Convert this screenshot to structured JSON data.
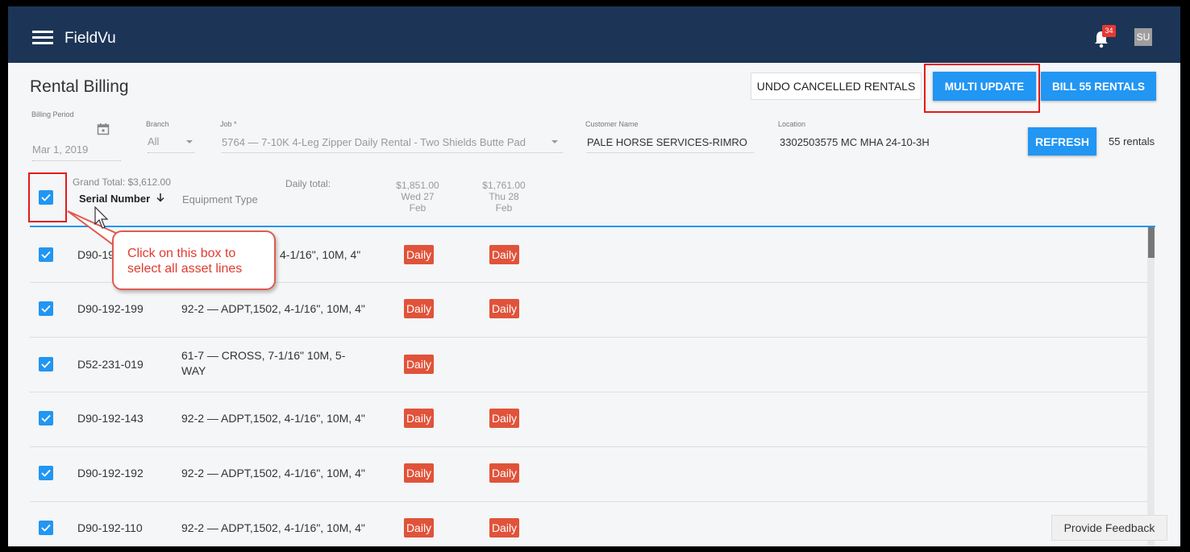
{
  "app": {
    "title": "FieldVu",
    "notification_count": "34",
    "user_initials": "SU"
  },
  "page": {
    "title": "Rental Billing"
  },
  "actions": {
    "undo_label": "UNDO CANCELLED RENTALS",
    "multi_update_label": "MULTI UPDATE",
    "bill_label": "BILL 55 RENTALS",
    "refresh_label": "REFRESH",
    "rentals_count": "55 rentals"
  },
  "filters": {
    "billing_period_label": "Billing Period",
    "billing_period_value": "Mar 1, 2019",
    "branch_label": "Branch",
    "branch_value": "All",
    "job_label": "Job *",
    "job_value": "5764 — 7-10K 4-Leg Zipper Daily Rental - Two Shields Butte Pad",
    "customer_label": "Customer Name",
    "customer_value": "PALE HORSE SERVICES-RIMRO",
    "location_label": "Location",
    "location_value": "3302503575 MC MHA 24-10-3H"
  },
  "table": {
    "grand_total": "Grand Total: $3,612.00",
    "daily_total_label": "Daily total:",
    "serial_header": "Serial Number",
    "equipment_header": "Equipment Type",
    "date_columns": [
      {
        "total": "$1,851.00",
        "day": "Wed 27",
        "month": "Feb"
      },
      {
        "total": "$1,761.00",
        "day": "Thu 28",
        "month": "Feb"
      }
    ],
    "rows": [
      {
        "serial": "D90-19",
        "equipment": "4-1/16\", 10M, 4\"",
        "col1": "Daily",
        "col2": "Daily"
      },
      {
        "serial": "D90-192-199",
        "equipment": "92-2 — ADPT,1502, 4-1/16\", 10M, 4\"",
        "col1": "Daily",
        "col2": "Daily"
      },
      {
        "serial": "D52-231-019",
        "equipment": "61-7 — CROSS, 7-1/16\" 10M, 5-WAY",
        "col1": "Daily",
        "col2": ""
      },
      {
        "serial": "D90-192-143",
        "equipment": "92-2 — ADPT,1502, 4-1/16\", 10M, 4\"",
        "col1": "Daily",
        "col2": "Daily"
      },
      {
        "serial": "D90-192-192",
        "equipment": "92-2 — ADPT,1502, 4-1/16\", 10M, 4\"",
        "col1": "Daily",
        "col2": "Daily"
      },
      {
        "serial": "D90-192-110",
        "equipment": "92-2 — ADPT,1502, 4-1/16\", 10M, 4\"",
        "col1": "Daily",
        "col2": "Daily"
      }
    ]
  },
  "annotation": {
    "text": "Click on this box to select all asset lines"
  },
  "feedback_label": "Provide Feedback",
  "colors": {
    "appbar": "#1c3557",
    "primary": "#2196f3",
    "daily_badge": "#e0533a",
    "highlight": "#e21b1b"
  }
}
